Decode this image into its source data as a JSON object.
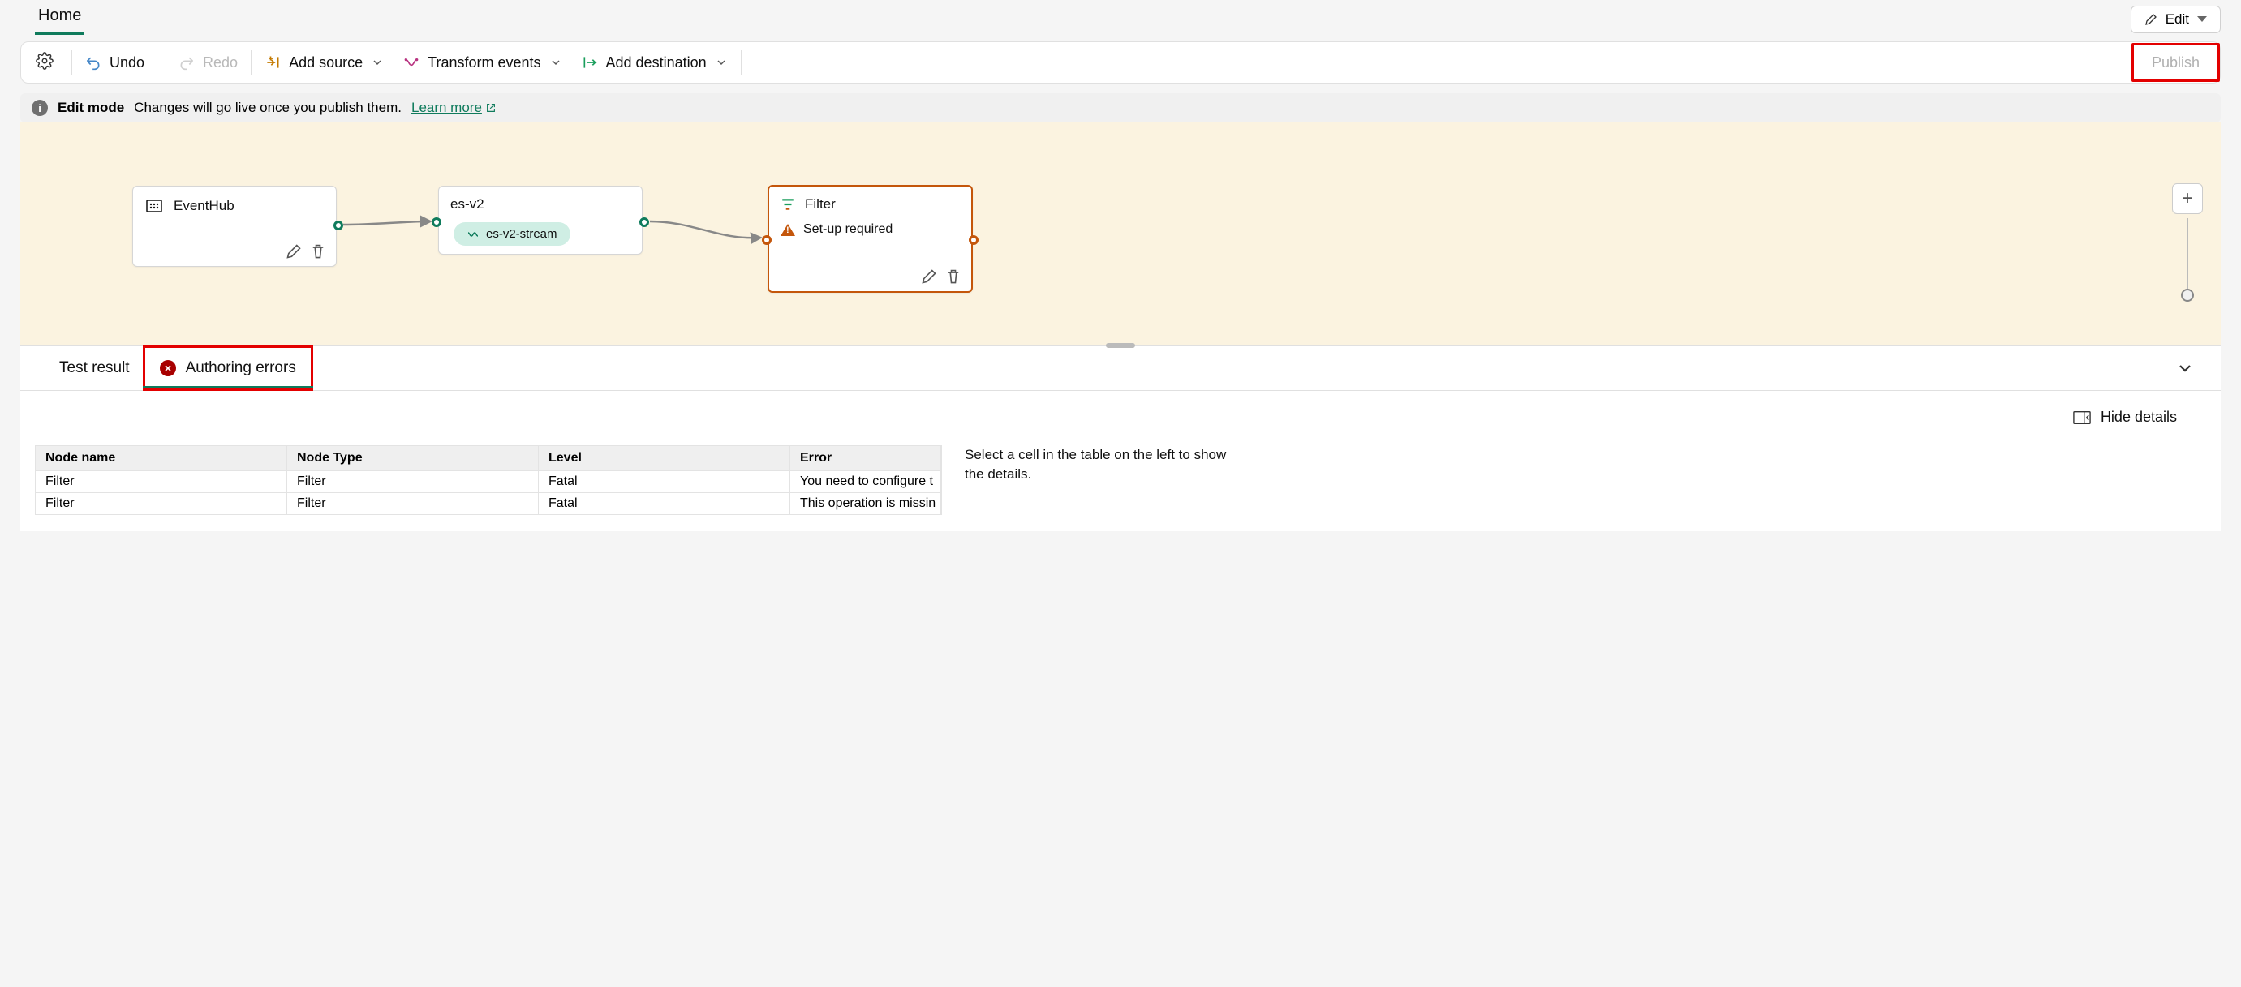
{
  "header": {
    "home": "Home",
    "edit": "Edit"
  },
  "toolbar": {
    "undo": "Undo",
    "redo": "Redo",
    "add_source": "Add source",
    "transform": "Transform events",
    "add_dest": "Add destination",
    "publish": "Publish"
  },
  "info": {
    "mode": "Edit mode",
    "msg": "Changes will go live once you publish them.",
    "learn": "Learn more"
  },
  "nodes": {
    "eventhub": {
      "title": "EventHub"
    },
    "esv2": {
      "title": "es-v2",
      "stream": "es-v2-stream"
    },
    "filter": {
      "title": "Filter",
      "warn": "Set-up required"
    }
  },
  "panel": {
    "tab_test": "Test result",
    "tab_err": "Authoring errors",
    "hide": "Hide details",
    "side": "Select a cell in the table on the left to show the details.",
    "cols": {
      "name": "Node name",
      "type": "Node Type",
      "level": "Level",
      "error": "Error"
    },
    "rows": [
      {
        "name": "Filter",
        "type": "Filter",
        "level": "Fatal",
        "error": "You need to configure t"
      },
      {
        "name": "Filter",
        "type": "Filter",
        "level": "Fatal",
        "error": "This operation is missin"
      }
    ]
  }
}
